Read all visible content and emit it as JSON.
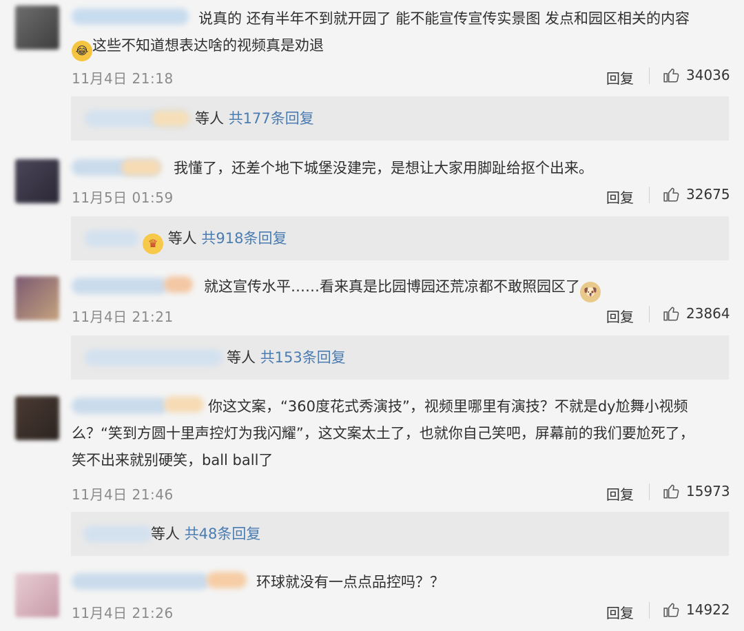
{
  "comments": [
    {
      "text": "说真的 还有半年不到就开园了 能不能宣传宣传实景图 发点和园区相关的内容",
      "text2": "这些不知道想表达啥的视频真是劝退",
      "time": "11月4日 21:18",
      "reply_label": "回复",
      "likes": "34036",
      "sub_people": "等人",
      "sub_count": "共177条回复"
    },
    {
      "text": "我懂了，还差个地下城堡没建完，是想让大家用脚趾给抠个出来。",
      "time": "11月5日 01:59",
      "reply_label": "回复",
      "likes": "32675",
      "sub_people": "等人",
      "sub_count": "共918条回复"
    },
    {
      "text": "就这宣传水平……看来真是比园博园还荒凉都不敢照园区了",
      "time": "11月4日 21:21",
      "reply_label": "回复",
      "likes": "23864",
      "sub_people": "等人",
      "sub_count": "共153条回复"
    },
    {
      "text": "你这文案，“360度花式秀演技”，视频里哪里有演技？不就是dy尬舞小视频",
      "text2": "么？“笑到方圆十里声控灯为我闪耀”，这文案太土了，也就你自己笑吧，屏幕前的我们要尬死了，",
      "text3": "笑不出来就别硬笑，ball ball了",
      "time": "11月4日 21:46",
      "reply_label": "回复",
      "likes": "15973",
      "sub_people": "等人",
      "sub_count": "共48条回复"
    },
    {
      "text": "环球就没有一点点品控吗？？",
      "time": "11月4日 21:26",
      "reply_label": "回复",
      "likes": "14922"
    }
  ],
  "colors": {
    "link": "#4a7cb1",
    "time": "#8a8a8a",
    "background": "#f4f4f4",
    "subbox": "#e9e9e9"
  },
  "icons": {
    "like": "thumbs-up-icon",
    "laugh_cry": "laugh-cry-emoji-icon",
    "doge": "doge-emoji-icon",
    "crown": "crown-badge-icon"
  }
}
